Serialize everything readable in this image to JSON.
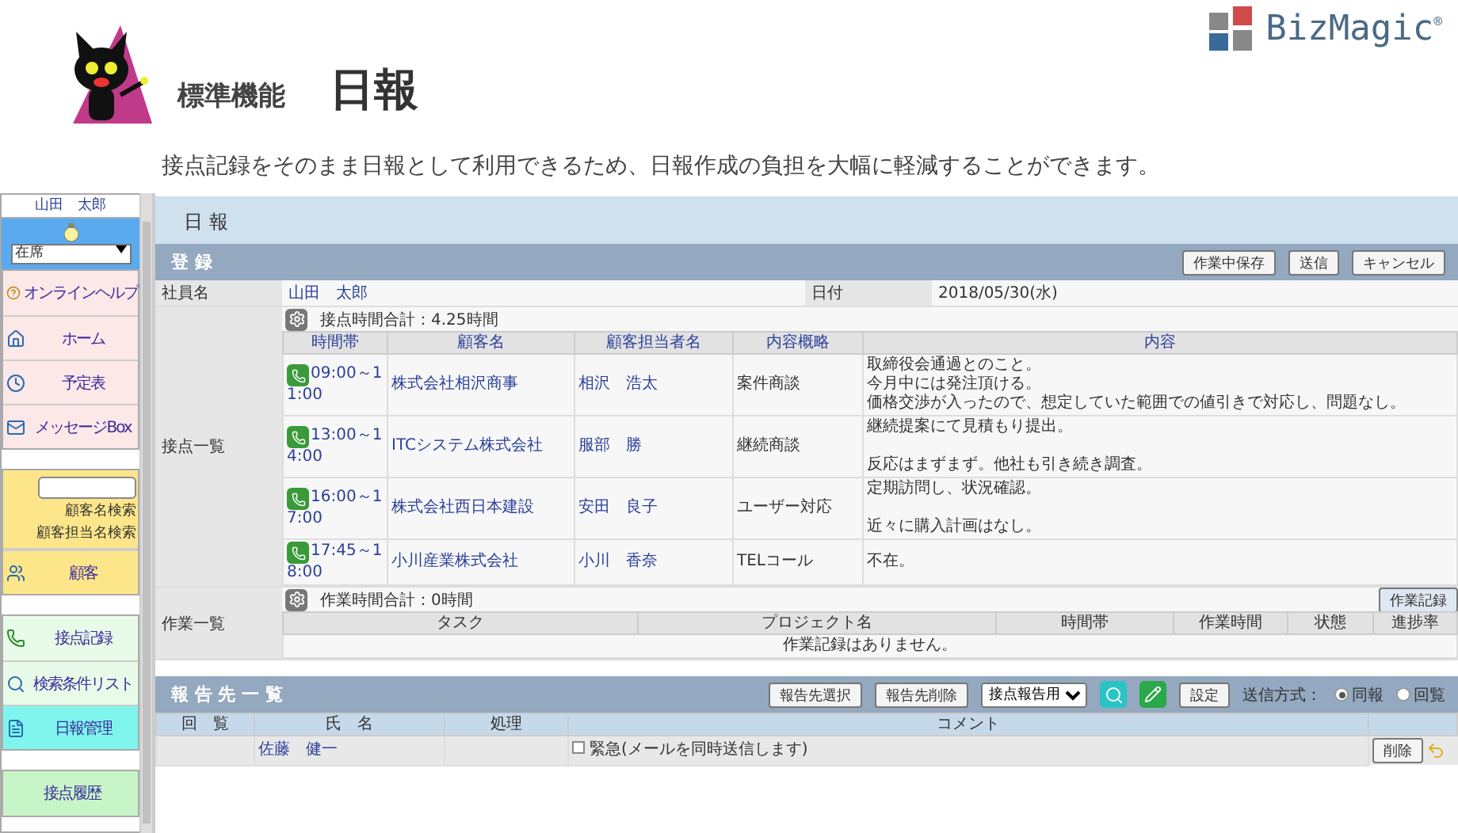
{
  "header": {
    "category": "標準機能",
    "title": "日報",
    "description": "接点記録をそのまま日報として利用できるため、日報作成の負担を大幅に軽減することができます。",
    "brand": "BizMagic$^{®}$"
  },
  "sidebar": {
    "user": "山田　太郎",
    "status": "在席",
    "groups": [
      {
        "color": "#fde8e8",
        "items": [
          {
            "kind": "help",
            "label": "オンラインヘルプ",
            "selected": false
          },
          {
            "kind": "home",
            "label": "ホーム",
            "selected": false
          },
          {
            "kind": "schedule",
            "label": "予定表",
            "selected": false
          },
          {
            "kind": "message",
            "label": "メッセージBox",
            "selected": false
          }
        ]
      },
      {
        "color": "#fde68a",
        "search": {
          "links": [
            "顧客名検索",
            "顧客担当名検索"
          ]
        },
        "items": [
          {
            "kind": "customer",
            "label": "顧客",
            "selected": false
          }
        ]
      },
      {
        "color": "#e8fbe8",
        "items": [
          {
            "kind": "contact",
            "label": "接点記録",
            "selected": false
          },
          {
            "kind": "search",
            "label": "検索条件リスト",
            "selected": false
          },
          {
            "kind": "report",
            "label": "日報管理",
            "selected": true
          }
        ]
      },
      {
        "color": "#c8f5c8",
        "items": [
          {
            "kind": "history",
            "label": "接点履歴",
            "selected": false
          }
        ]
      }
    ]
  },
  "page_title": "日 報",
  "register": {
    "title": "登 録",
    "buttons": [
      "作業中保存",
      "送信",
      "キャンセル"
    ],
    "employee_label": "社員名",
    "employee": "山田　太郎",
    "date_label": "日付",
    "date": "2018/05/30(水)",
    "contacts_label": "接点一覧",
    "contacts_total": "接点時間合計：4.25時間",
    "contacts_columns": [
      "時間帯",
      "顧客名",
      "顧客担当者名",
      "内容概略",
      "内容"
    ],
    "contacts": [
      {
        "time": "09:00～11:00",
        "customer": "株式会社相沢商事",
        "person": "相沢　浩太",
        "summary": "案件商談",
        "content": [
          [
            "取締役会通過とのこと。",
            "今月中には発注頂ける。",
            "価格交渉が入ったので、想定していた範囲での値引きで対応し、問題なし。"
          ]
        ]
      },
      {
        "time": "13:00～14:00",
        "customer": "ITCシステム株式会社",
        "person": "服部　勝",
        "summary": "継続商談",
        "content": [
          [
            "継続提案にて見積もり提出。"
          ],
          [
            "反応はまずまず。他社も引き続き調査。"
          ]
        ]
      },
      {
        "time": "16:00～17:00",
        "customer": "株式会社西日本建設",
        "person": "安田　良子",
        "summary": "ユーザー対応",
        "content": [
          [
            "定期訪問し、状況確認。"
          ],
          [
            "近々に購入計画はなし。"
          ]
        ]
      },
      {
        "time": "17:45～18:00",
        "customer": "小川産業株式会社",
        "person": "小川　香奈",
        "summary": "TELコール",
        "content": [
          [
            "不在。"
          ]
        ]
      }
    ],
    "tasks_label": "作業一覧",
    "tasks_total": "作業時間合計：0時間",
    "tasks_button": "作業記録",
    "tasks_columns": [
      "タスク",
      "プロジェクト名",
      "時間帯",
      "作業時間",
      "状態",
      "進捗率"
    ],
    "tasks_empty": "作業記録はありません。"
  },
  "recipients": {
    "title": "報 告 先 一 覧",
    "buttons": [
      "報告先選択",
      "報告先削除"
    ],
    "template": "接点報告用",
    "settings": "設定",
    "method_label": "送信方式：",
    "methods": [
      {
        "label": "同報",
        "selected": true
      },
      {
        "label": "回覧",
        "selected": false
      }
    ],
    "columns": [
      "回　覧",
      "氏　名",
      "処理",
      "コメント"
    ],
    "rows": [
      {
        "name": "佐藤　健一",
        "urgent": false,
        "urgent_label": "緊急(メールを同時送信します)",
        "delete": "削除"
      }
    ]
  }
}
